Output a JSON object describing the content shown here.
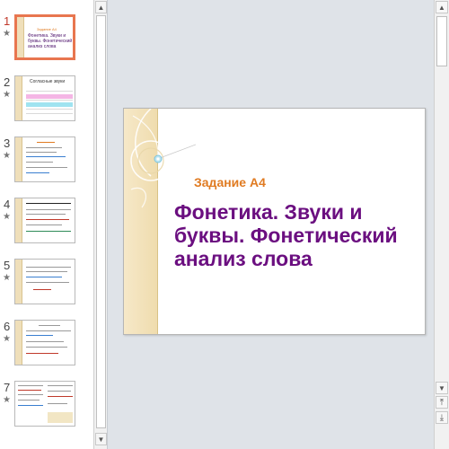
{
  "thumbnails": [
    {
      "number": "1",
      "star": "★",
      "title": "Фонетика. Звуки и буквы. Фонетический анализ слова",
      "subtitle": "Задание А4",
      "active": true
    },
    {
      "number": "2",
      "star": "★",
      "title": "Согласные звуки"
    },
    {
      "number": "3",
      "star": "★"
    },
    {
      "number": "4",
      "star": "★"
    },
    {
      "number": "5",
      "star": "★"
    },
    {
      "number": "6",
      "star": "★"
    },
    {
      "number": "7",
      "star": "★"
    }
  ],
  "slide": {
    "task_label": "Задание А4",
    "title": "Фонетика. Звуки и буквы. Фонетический анализ слова"
  },
  "scrollbar": {
    "up_glyph": "▲",
    "down_glyph": "▼",
    "prev_slide_glyph": "⤒",
    "next_slide_glyph": "⤓"
  },
  "colors": {
    "accent_orange": "#e07b22",
    "title_purple": "#6b0f80",
    "active_border": "#e8764f"
  }
}
